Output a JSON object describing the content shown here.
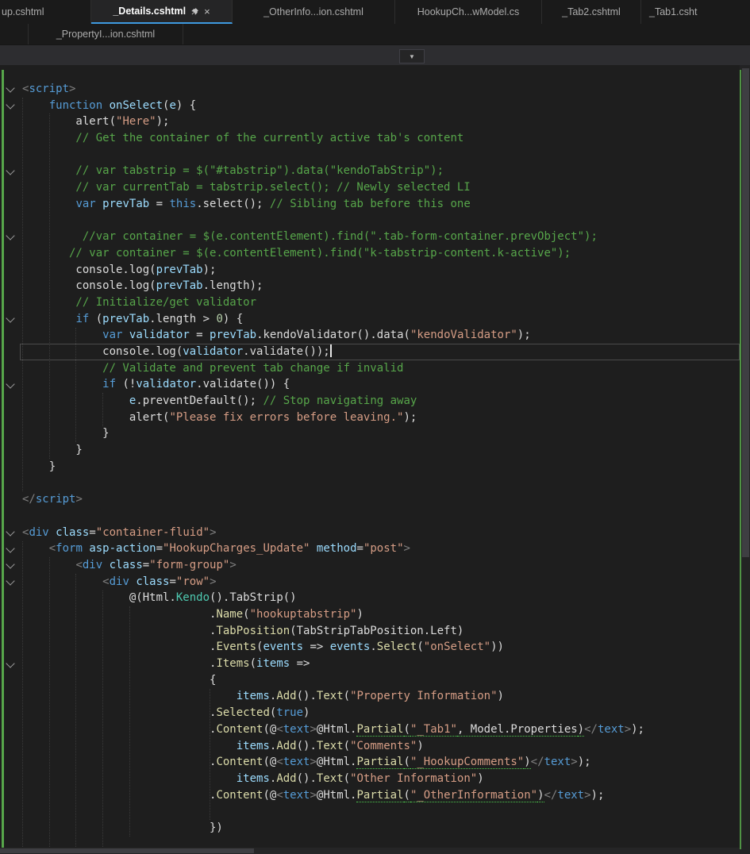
{
  "tab_bar": {
    "close_glyph": "×",
    "row1": [
      {
        "label": "up.cshtml",
        "active": false,
        "cropped": "left"
      },
      {
        "label": "_Details.cshtml",
        "active": true,
        "pinned": true
      },
      {
        "label": "_OtherInfo...ion.cshtml",
        "active": false
      },
      {
        "label": "HookupCh...wModel.cs",
        "active": false
      },
      {
        "label": "_Tab2.cshtml",
        "active": false
      },
      {
        "label": "_Tab1.csht",
        "active": false,
        "cropped": "right"
      }
    ],
    "row2": [
      {
        "label": "",
        "active": false
      },
      {
        "label": "_PropertyI...ion.cshtml",
        "active": false
      }
    ]
  },
  "nav": {
    "dropdown_icon": "▼"
  },
  "editor": {
    "current_line": 16,
    "caret_line": 16,
    "fold_lines": [
      0,
      1,
      5,
      9,
      14,
      18,
      27,
      28,
      29,
      30,
      35
    ],
    "colors": {
      "background": "#1E1E1E",
      "keyword": "#569CD6",
      "comment": "#57A64A",
      "string": "#D69D85",
      "number": "#B5CEA8",
      "method": "#DCDCAA",
      "variable": "#9CDCFE",
      "html_delimiter": "#808080",
      "type": "#4EC9B0",
      "default_text": "#DCDCDC",
      "change_bar": "#57A64A",
      "active_tab_accent": "#3E9AE0"
    },
    "lines": [
      [
        [
          "d",
          "<"
        ],
        [
          "k",
          "script"
        ],
        [
          "d",
          ">"
        ]
      ],
      [
        [
          "p",
          "    "
        ],
        [
          "k",
          "function"
        ],
        [
          "p",
          " "
        ],
        [
          "v",
          "onSelect"
        ],
        [
          "p",
          "("
        ],
        [
          "v",
          "e"
        ],
        [
          "p",
          ") {"
        ]
      ],
      [
        [
          "p",
          "        alert("
        ],
        [
          "s",
          "\"Here\""
        ],
        [
          "p",
          ");"
        ]
      ],
      [
        [
          "c",
          "        // Get the container of the currently active tab's content"
        ]
      ],
      [],
      [
        [
          "c",
          "        // var tabstrip = $(\"#tabstrip\").data(\"kendoTabStrip\");"
        ]
      ],
      [
        [
          "c",
          "        // var currentTab = tabstrip.select(); // Newly selected LI"
        ]
      ],
      [
        [
          "p",
          "        "
        ],
        [
          "k",
          "var"
        ],
        [
          "p",
          " "
        ],
        [
          "v",
          "prevTab"
        ],
        [
          "p",
          " = "
        ],
        [
          "k",
          "this"
        ],
        [
          "p",
          ".select(); "
        ],
        [
          "c",
          "// Sibling tab before this one"
        ]
      ],
      [],
      [
        [
          "c",
          "         //var container = $(e.contentElement).find(\".tab-form-container.prevObject\");"
        ]
      ],
      [
        [
          "c",
          "       // var container = $(e.contentElement).find(\"k-tabstrip-content.k-active\");"
        ]
      ],
      [
        [
          "p",
          "        console.log("
        ],
        [
          "v",
          "prevTab"
        ],
        [
          "p",
          ");"
        ]
      ],
      [
        [
          "p",
          "        console.log("
        ],
        [
          "v",
          "prevTab"
        ],
        [
          "p",
          ".length);"
        ]
      ],
      [
        [
          "c",
          "        // Initialize/get validator"
        ]
      ],
      [
        [
          "p",
          "        "
        ],
        [
          "k",
          "if"
        ],
        [
          "p",
          " ("
        ],
        [
          "v",
          "prevTab"
        ],
        [
          "p",
          ".length > "
        ],
        [
          "n",
          "0"
        ],
        [
          "p",
          ") {"
        ]
      ],
      [
        [
          "p",
          "            "
        ],
        [
          "k",
          "var"
        ],
        [
          "p",
          " "
        ],
        [
          "v",
          "validator"
        ],
        [
          "p",
          " = "
        ],
        [
          "v",
          "prevTab"
        ],
        [
          "p",
          ".kendoValidator().data("
        ],
        [
          "s",
          "\"kendoValidator\""
        ],
        [
          "p",
          ");"
        ]
      ],
      [
        [
          "p",
          "            console.log("
        ],
        [
          "v",
          "validator"
        ],
        [
          "p",
          ".validate());"
        ]
      ],
      [
        [
          "c",
          "            // Validate and prevent tab change if invalid"
        ]
      ],
      [
        [
          "p",
          "            "
        ],
        [
          "k",
          "if"
        ],
        [
          "p",
          " (!"
        ],
        [
          "v",
          "validator"
        ],
        [
          "p",
          ".validate()) {"
        ]
      ],
      [
        [
          "p",
          "                "
        ],
        [
          "v",
          "e"
        ],
        [
          "p",
          ".preventDefault(); "
        ],
        [
          "c",
          "// Stop navigating away"
        ]
      ],
      [
        [
          "p",
          "                alert("
        ],
        [
          "s",
          "\"Please fix errors before leaving.\""
        ],
        [
          "p",
          ");"
        ]
      ],
      [
        [
          "p",
          "            }"
        ]
      ],
      [
        [
          "p",
          "        }"
        ]
      ],
      [
        [
          "p",
          "    }"
        ]
      ],
      [],
      [
        [
          "d",
          "</"
        ],
        [
          "k",
          "script"
        ],
        [
          "d",
          ">"
        ]
      ],
      [],
      [
        [
          "d",
          "<"
        ],
        [
          "k",
          "div"
        ],
        [
          "p",
          " "
        ],
        [
          "v",
          "class"
        ],
        [
          "p",
          "="
        ],
        [
          "s",
          "\"container-fluid\""
        ],
        [
          "d",
          ">"
        ]
      ],
      [
        [
          "p",
          "    "
        ],
        [
          "d",
          "<"
        ],
        [
          "k",
          "form"
        ],
        [
          "p",
          " "
        ],
        [
          "v",
          "asp-action"
        ],
        [
          "p",
          "="
        ],
        [
          "s",
          "\"HookupCharges_Update\""
        ],
        [
          "p",
          " "
        ],
        [
          "v",
          "method"
        ],
        [
          "p",
          "="
        ],
        [
          "s",
          "\"post\""
        ],
        [
          "d",
          ">"
        ]
      ],
      [
        [
          "p",
          "        "
        ],
        [
          "d",
          "<"
        ],
        [
          "k",
          "div"
        ],
        [
          "p",
          " "
        ],
        [
          "v",
          "class"
        ],
        [
          "p",
          "="
        ],
        [
          "s",
          "\"form-group\""
        ],
        [
          "d",
          ">"
        ]
      ],
      [
        [
          "p",
          "            "
        ],
        [
          "d",
          "<"
        ],
        [
          "k",
          "div"
        ],
        [
          "p",
          " "
        ],
        [
          "v",
          "class"
        ],
        [
          "p",
          "="
        ],
        [
          "s",
          "\"row\""
        ],
        [
          "d",
          ">"
        ]
      ],
      [
        [
          "p",
          "                @(Html."
        ],
        [
          "t",
          "Kendo"
        ],
        [
          "p",
          "().TabStrip()"
        ]
      ],
      [
        [
          "p",
          "                            ."
        ],
        [
          "m",
          "Name"
        ],
        [
          "p",
          "("
        ],
        [
          "s",
          "\"hookuptabstrip\""
        ],
        [
          "p",
          ")"
        ]
      ],
      [
        [
          "p",
          "                            ."
        ],
        [
          "m",
          "TabPosition"
        ],
        [
          "p",
          "(TabStripTabPosition.Left)"
        ]
      ],
      [
        [
          "p",
          "                            ."
        ],
        [
          "m",
          "Events"
        ],
        [
          "p",
          "("
        ],
        [
          "v",
          "events"
        ],
        [
          "p",
          " => "
        ],
        [
          "v",
          "events"
        ],
        [
          "p",
          "."
        ],
        [
          "m",
          "Select"
        ],
        [
          "p",
          "("
        ],
        [
          "s",
          "\"onSelect\""
        ],
        [
          "p",
          "))"
        ]
      ],
      [
        [
          "p",
          "                            ."
        ],
        [
          "m",
          "Items"
        ],
        [
          "p",
          "("
        ],
        [
          "v",
          "items"
        ],
        [
          "p",
          " =>"
        ]
      ],
      [
        [
          "p",
          "                            {"
        ]
      ],
      [
        [
          "p",
          "                                "
        ],
        [
          "v",
          "items"
        ],
        [
          "p",
          "."
        ],
        [
          "m",
          "Add"
        ],
        [
          "p",
          "()."
        ],
        [
          "m",
          "Text"
        ],
        [
          "p",
          "("
        ],
        [
          "s",
          "\"Property Information\""
        ],
        [
          "p",
          ")"
        ]
      ],
      [
        [
          "p",
          "                            ."
        ],
        [
          "m",
          "Selected"
        ],
        [
          "p",
          "("
        ],
        [
          "k",
          "true"
        ],
        [
          "p",
          ")"
        ]
      ],
      [
        [
          "p",
          "                            ."
        ],
        [
          "m",
          "Content"
        ],
        [
          "p",
          "(@"
        ],
        [
          "d",
          "<"
        ],
        [
          "k",
          "text"
        ],
        [
          "d",
          ">"
        ],
        [
          "p",
          "@Html."
        ],
        [
          "m",
          "Partial",
          1
        ],
        [
          "p",
          "(",
          1
        ],
        [
          "s",
          "\"_Tab1\"",
          1
        ],
        [
          "p",
          ", Model.Properties",
          1
        ],
        [
          "p",
          ")",
          1
        ],
        [
          "d",
          "</"
        ],
        [
          "k",
          "text"
        ],
        [
          "d",
          ">"
        ],
        [
          "p",
          ");"
        ]
      ],
      [
        [
          "p",
          "                                "
        ],
        [
          "v",
          "items"
        ],
        [
          "p",
          "."
        ],
        [
          "m",
          "Add"
        ],
        [
          "p",
          "()."
        ],
        [
          "m",
          "Text"
        ],
        [
          "p",
          "("
        ],
        [
          "s",
          "\"Comments\""
        ],
        [
          "p",
          ")"
        ]
      ],
      [
        [
          "p",
          "                            ."
        ],
        [
          "m",
          "Content"
        ],
        [
          "p",
          "(@"
        ],
        [
          "d",
          "<"
        ],
        [
          "k",
          "text"
        ],
        [
          "d",
          ">"
        ],
        [
          "p",
          "@Html."
        ],
        [
          "m",
          "Partial",
          1
        ],
        [
          "p",
          "(",
          1
        ],
        [
          "s",
          "\"_HookupComments\"",
          1
        ],
        [
          "p",
          ")",
          1
        ],
        [
          "d",
          "</"
        ],
        [
          "k",
          "text"
        ],
        [
          "d",
          ">"
        ],
        [
          "p",
          ");"
        ]
      ],
      [
        [
          "p",
          "                                "
        ],
        [
          "v",
          "items"
        ],
        [
          "p",
          "."
        ],
        [
          "m",
          "Add"
        ],
        [
          "p",
          "()."
        ],
        [
          "m",
          "Text"
        ],
        [
          "p",
          "("
        ],
        [
          "s",
          "\"Other Information\""
        ],
        [
          "p",
          ")"
        ]
      ],
      [
        [
          "p",
          "                            ."
        ],
        [
          "m",
          "Content"
        ],
        [
          "p",
          "(@"
        ],
        [
          "d",
          "<"
        ],
        [
          "k",
          "text"
        ],
        [
          "d",
          ">"
        ],
        [
          "p",
          "@Html."
        ],
        [
          "m",
          "Partial",
          1
        ],
        [
          "p",
          "(",
          1
        ],
        [
          "s",
          "\"_OtherInformation\"",
          1
        ],
        [
          "p",
          ")",
          1
        ],
        [
          "d",
          "</"
        ],
        [
          "k",
          "text"
        ],
        [
          "d",
          ">"
        ],
        [
          "p",
          ");"
        ]
      ],
      [],
      [
        [
          "p",
          "                            })"
        ]
      ],
      []
    ]
  }
}
